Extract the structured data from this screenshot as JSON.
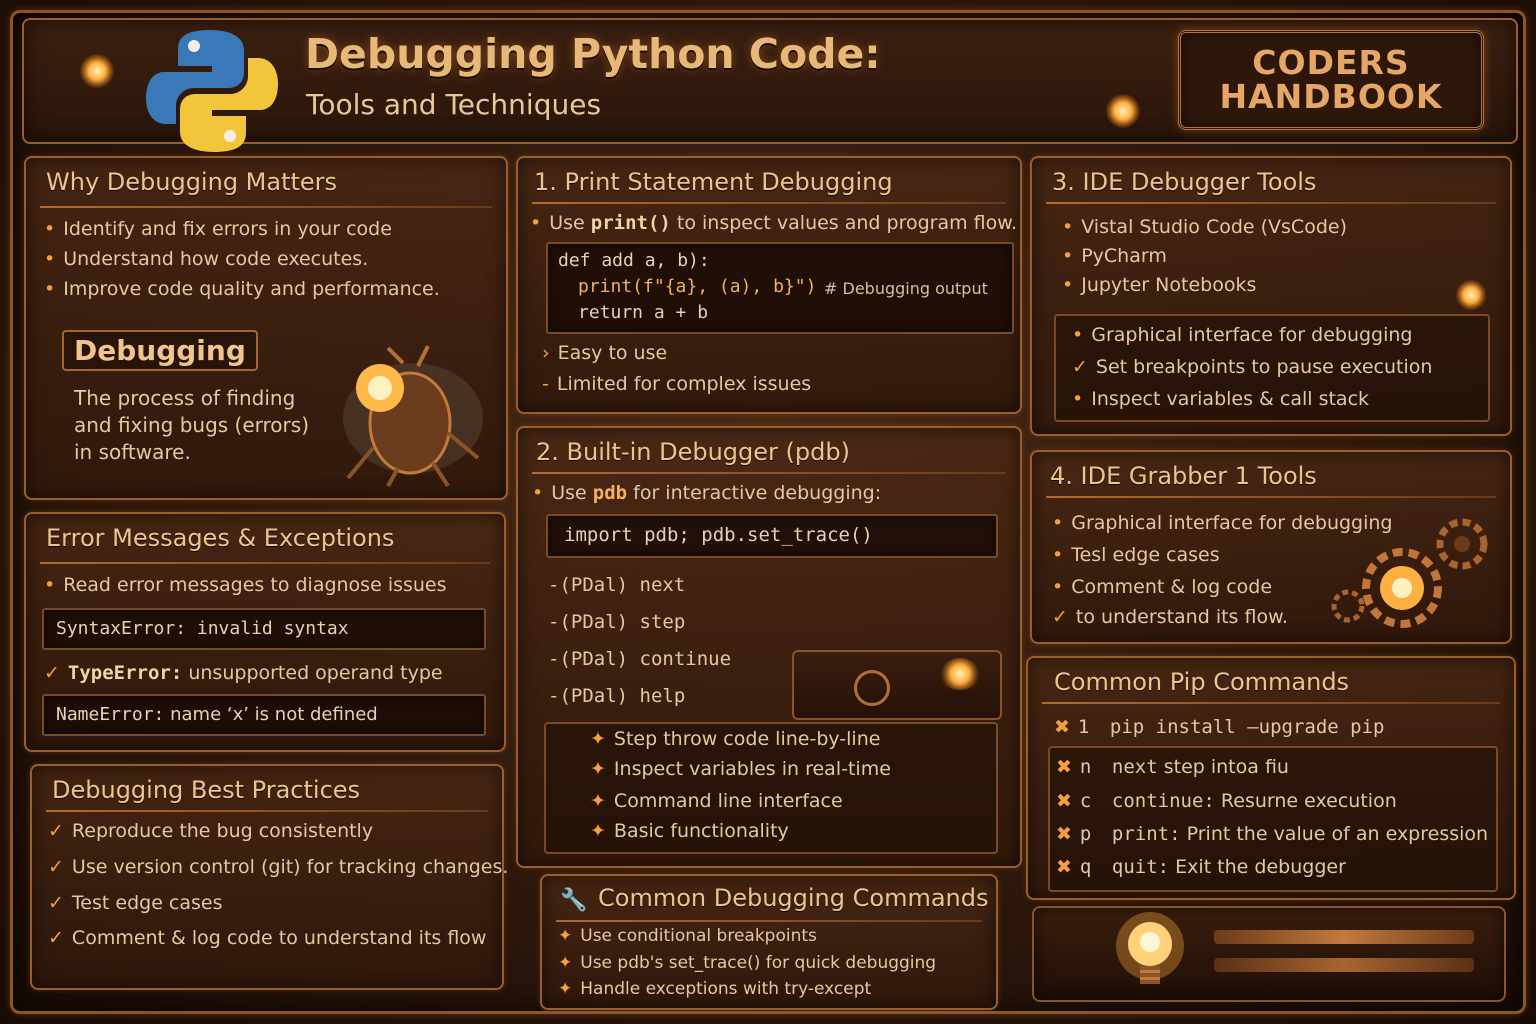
{
  "header": {
    "title": "Debugging Python Code:",
    "subtitle": "Tools and Techniques",
    "brand_line1": "CODERS",
    "brand_line2": "HANDBOOK",
    "logo_icon": "python-logo-icon"
  },
  "why": {
    "title": "Why Debugging Matters",
    "items": [
      "Identify and fix errors in your code",
      "Understand how code executes.",
      "Improve code quality and performance."
    ],
    "def_label": "Debugging",
    "def_lines": [
      "The process of finding",
      "and fixing bugs (errors)",
      "in software."
    ],
    "bug_icon": "bug-robot-icon"
  },
  "errors": {
    "title": "Error Messages & Exceptions",
    "intro": "Read error messages to diagnose issues",
    "syntax_code": "SyntaxError:  invalid syntax",
    "type_name": "TypeError:",
    "type_desc": " unsupported operand type",
    "name_code": "NameError:",
    "name_desc": " name  ‘x’ is not defined"
  },
  "best": {
    "title": "Debugging Best Practices",
    "items": [
      "Reproduce the bug consistently",
      "Use version control (git) for tracking changes.",
      "Test edge cases",
      "Comment & log code to understand its flow"
    ]
  },
  "print": {
    "title": "1. Print Statement Debugging",
    "intro_pre": "Use ",
    "intro_code": "print()",
    "intro_post": " to inspect values and program flow.",
    "code_lines": [
      "def add a, b):",
      "print(f\"{a}, (a), b}\")",
      "# Debugging output",
      "return a + b"
    ],
    "pro": "Easy to use",
    "con": "Limited for complex issues"
  },
  "pdb": {
    "title": "2. Built-in Debugger (pdb)",
    "intro_pre": "Use ",
    "intro_code": "pdb",
    "intro_post": " for interactive debugging:",
    "code": "import pdb; pdb.set_trace()",
    "commands": [
      "-(PDal) next",
      "-(PDal) step",
      "-(PDal) continue",
      "-(PDal) help"
    ],
    "features": [
      "Step throw code line-by-line",
      "Inspect  variables in real-time",
      "Command line interface",
      "Basic functionality"
    ]
  },
  "common": {
    "title": "Common Debugging Commands",
    "items": [
      "Use conditional breakpoints",
      "Use pdb's set_trace() for quick debugging",
      "Handle exceptions with try-except"
    ],
    "icon": "wrench-icon"
  },
  "ide": {
    "title": "3. IDE Debugger Tools",
    "tools": [
      "Vistal Studio Code (VsCode)",
      "PyCharm",
      "Jupyter Notebooks"
    ],
    "features": [
      "Graphical interface for debugging",
      "Set breakpoints to pause execution",
      "Inspect variables & call stack"
    ]
  },
  "grabber": {
    "title": "4. IDE Grabber 1 Tools",
    "items": [
      "Graphical interface for debugging",
      "Tesl edge cases",
      "Comment & log code",
      "to understand its flow."
    ],
    "gears_icon": "gears-icon"
  },
  "pip": {
    "title": "Common Pip Commands",
    "rows": [
      {
        "key": "1",
        "cmd": "pip install —upgrade  pip",
        "desc": ""
      },
      {
        "key": "n",
        "cmd": "next",
        "desc": " step intoa fiu"
      },
      {
        "key": "c",
        "cmd": "continue:",
        "desc": " Resurne execution"
      },
      {
        "key": "p",
        "cmd": "print:",
        "desc": " Print the value of an expression"
      },
      {
        "key": "q",
        "cmd": "quit:",
        "desc": " Exit the debugger"
      }
    ],
    "bulb_icon": "light-bulb-icon"
  }
}
